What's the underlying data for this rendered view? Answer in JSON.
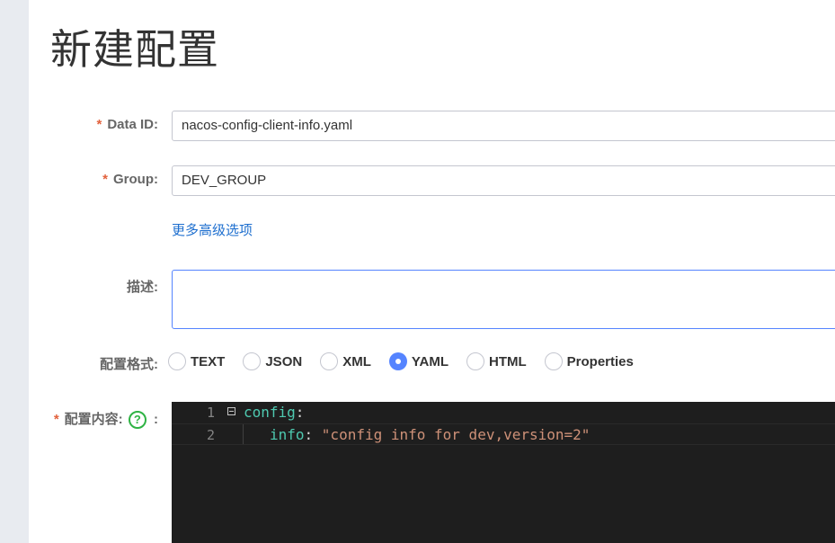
{
  "page": {
    "title": "新建配置"
  },
  "form": {
    "data_id": {
      "required_mark": "*",
      "label": "Data ID:",
      "value": "nacos-config-client-info.yaml"
    },
    "group": {
      "required_mark": "*",
      "label": "Group:",
      "value": "DEV_GROUP"
    },
    "advanced_link": "更多高级选项",
    "description": {
      "label": "描述:",
      "value": ""
    },
    "format": {
      "label": "配置格式:",
      "options": [
        "TEXT",
        "JSON",
        "XML",
        "YAML",
        "HTML",
        "Properties"
      ],
      "selected": "YAML"
    },
    "content": {
      "required_mark": "*",
      "label": "配置内容:",
      "help_icon": "question-circle-icon",
      "help_glyph": "?",
      "suffix": ":"
    }
  },
  "editor": {
    "lines": [
      {
        "number": "1",
        "key": "config",
        "sep": ":",
        "value": ""
      },
      {
        "number": "2",
        "key": "info",
        "sep": ": ",
        "value": "\"config info for dev,version=2\""
      }
    ],
    "theme": {
      "background": "#1e1e1e",
      "key_color": "#4ec9b0",
      "string_color": "#ce9178"
    }
  },
  "colors": {
    "required": "#e2613c",
    "link": "#1e6fcf",
    "radio_checked": "#5584ff",
    "help_icon": "#2fb344"
  }
}
